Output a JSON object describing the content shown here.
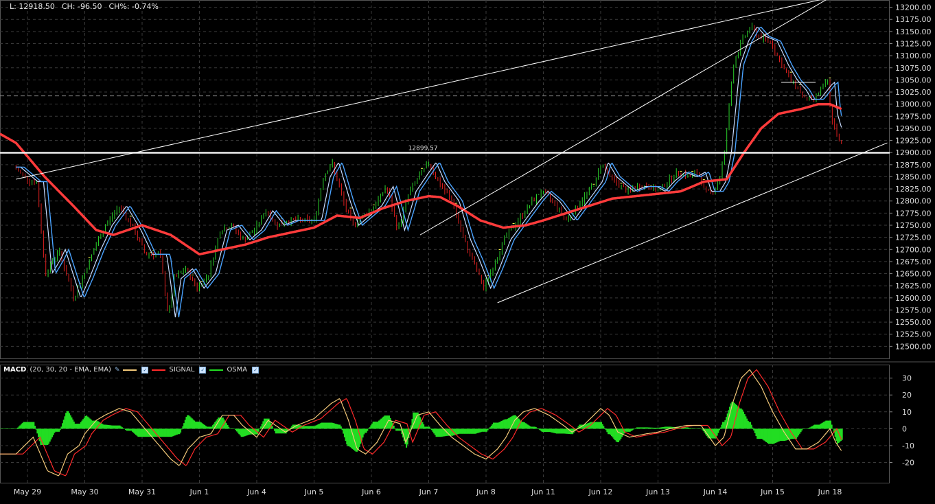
{
  "header": {
    "last": "L: 12918.50",
    "change": "CH: -96.50",
    "change_pct": "CH%: -0.74%"
  },
  "macd_legend": {
    "name": "MACD",
    "params": "(20, 30, 20 - EMA, EMA)",
    "signal_label": "SIGNAL",
    "osma_label": "OSMA",
    "macd_color": "#f2c879",
    "signal_color": "#ff2a2a",
    "osma_color": "#22dd22"
  },
  "colors": {
    "background": "#000000",
    "grid": "#3a3a3a",
    "up_candle": "#2bd42b",
    "down_candle": "#e02020",
    "fast_ma": "#4aa3ff",
    "slow_ma": "#ff3b3b",
    "trendline": "#ffffff",
    "marker": "#ffff55"
  },
  "chart_data": [
    {
      "type": "line",
      "title": "",
      "x_ticks": [
        "May 29",
        "May 30",
        "May 31",
        "Jun 1",
        "Jun 4",
        "Jun 5",
        "Jun 6",
        "Jun 7",
        "Jun 8",
        "Jun 11",
        "Jun 12",
        "Jun 13",
        "Jun 14",
        "Jun 15",
        "Jun 18"
      ],
      "ylim": [
        12475,
        13215
      ],
      "y_ticks": [
        12500,
        12525,
        12550,
        12575,
        12600,
        12625,
        12650,
        12675,
        12700,
        12725,
        12750,
        12775,
        12800,
        12825,
        12850,
        12875,
        12900,
        12925,
        12950,
        12975,
        13000,
        13025,
        13050,
        13075,
        13100,
        13125,
        13150,
        13175,
        13200
      ],
      "y_tick_labels": [
        "12500.00",
        "12525.00",
        "12550.00",
        "12575.00",
        "12600.00",
        "12625.00",
        "12650.00",
        "12675.00",
        "12700.00",
        "12725.00",
        "12750.00",
        "12775.00",
        "12800.00",
        "12825.00",
        "12850.00",
        "12875.00",
        "12900.00",
        "12925.00",
        "12950.00",
        "12975.00",
        "13000.00",
        "13025.00",
        "13050.00",
        "13075.00",
        "13100.00",
        "13125.00",
        "13150.00",
        "13175.00",
        "13200.00"
      ],
      "grid": true,
      "price_anchors": [
        [
          -0.2,
          12870
        ],
        [
          0.1,
          12840
        ],
        [
          0.2,
          12840
        ],
        [
          0.35,
          12650
        ],
        [
          0.5,
          12680
        ],
        [
          0.58,
          12700
        ],
        [
          0.85,
          12600
        ],
        [
          1.0,
          12640
        ],
        [
          1.2,
          12700
        ],
        [
          1.4,
          12750
        ],
        [
          1.65,
          12790
        ],
        [
          1.9,
          12740
        ],
        [
          2.1,
          12690
        ],
        [
          2.35,
          12690
        ],
        [
          2.5,
          12560
        ],
        [
          2.6,
          12640
        ],
        [
          2.8,
          12660
        ],
        [
          3.0,
          12620
        ],
        [
          3.2,
          12650
        ],
        [
          3.4,
          12740
        ],
        [
          3.6,
          12750
        ],
        [
          3.8,
          12720
        ],
        [
          4.0,
          12740
        ],
        [
          4.2,
          12780
        ],
        [
          4.4,
          12750
        ],
        [
          4.6,
          12760
        ],
        [
          4.8,
          12760
        ],
        [
          5.05,
          12760
        ],
        [
          5.2,
          12850
        ],
        [
          5.35,
          12880
        ],
        [
          5.55,
          12800
        ],
        [
          5.7,
          12750
        ],
        [
          5.9,
          12770
        ],
        [
          6.1,
          12790
        ],
        [
          6.3,
          12830
        ],
        [
          6.5,
          12740
        ],
        [
          6.7,
          12820
        ],
        [
          6.9,
          12855
        ],
        [
          7.05,
          12880
        ],
        [
          7.2,
          12840
        ],
        [
          7.45,
          12800
        ],
        [
          7.65,
          12720
        ],
        [
          7.8,
          12680
        ],
        [
          8.0,
          12620
        ],
        [
          8.15,
          12660
        ],
        [
          8.35,
          12720
        ],
        [
          8.6,
          12760
        ],
        [
          8.85,
          12800
        ],
        [
          9.0,
          12820
        ],
        [
          9.2,
          12800
        ],
        [
          9.45,
          12760
        ],
        [
          9.7,
          12800
        ],
        [
          9.95,
          12840
        ],
        [
          10.05,
          12880
        ],
        [
          10.2,
          12850
        ],
        [
          10.5,
          12820
        ],
        [
          10.7,
          12830
        ],
        [
          10.9,
          12830
        ],
        [
          11.05,
          12820
        ],
        [
          11.2,
          12840
        ],
        [
          11.4,
          12860
        ],
        [
          11.6,
          12850
        ],
        [
          11.75,
          12860
        ],
        [
          11.85,
          12820
        ],
        [
          12.0,
          12820
        ],
        [
          12.1,
          12840
        ],
        [
          12.2,
          12900
        ],
        [
          12.35,
          13080
        ],
        [
          12.5,
          13130
        ],
        [
          12.65,
          13160
        ],
        [
          12.8,
          13140
        ],
        [
          13.0,
          13130
        ],
        [
          13.2,
          13080
        ],
        [
          13.35,
          13050
        ],
        [
          13.5,
          13030
        ],
        [
          13.6,
          13010
        ],
        [
          13.75,
          13010
        ],
        [
          13.95,
          13040
        ],
        [
          14.0,
          13045
        ],
        [
          14.05,
          12980
        ],
        [
          14.15,
          12940
        ],
        [
          14.2,
          12920
        ]
      ],
      "series": [
        {
          "role": "fast_ma"
        },
        {
          "role": "slow_ma",
          "anchors": [
            [
              -0.5,
              12940
            ],
            [
              -0.2,
              12920
            ],
            [
              0.3,
              12850
            ],
            [
              0.8,
              12790
            ],
            [
              1.2,
              12740
            ],
            [
              1.5,
              12730
            ],
            [
              2.0,
              12750
            ],
            [
              2.5,
              12730
            ],
            [
              3.0,
              12690
            ],
            [
              3.4,
              12700
            ],
            [
              3.8,
              12710
            ],
            [
              4.2,
              12725
            ],
            [
              4.6,
              12735
            ],
            [
              5.0,
              12745
            ],
            [
              5.4,
              12770
            ],
            [
              5.8,
              12765
            ],
            [
              6.2,
              12785
            ],
            [
              6.6,
              12800
            ],
            [
              7.0,
              12810
            ],
            [
              7.2,
              12808
            ],
            [
              7.5,
              12790
            ],
            [
              7.9,
              12760
            ],
            [
              8.3,
              12745
            ],
            [
              8.7,
              12750
            ],
            [
              9.0,
              12760
            ],
            [
              9.4,
              12775
            ],
            [
              9.8,
              12790
            ],
            [
              10.2,
              12805
            ],
            [
              10.6,
              12810
            ],
            [
              11.0,
              12815
            ],
            [
              11.4,
              12820
            ],
            [
              11.8,
              12840
            ],
            [
              12.2,
              12845
            ],
            [
              12.5,
              12900
            ],
            [
              12.8,
              12950
            ],
            [
              13.1,
              12980
            ],
            [
              13.5,
              12990
            ],
            [
              13.8,
              13000
            ],
            [
              14.0,
              13000
            ],
            [
              14.2,
              12990
            ]
          ]
        }
      ],
      "horizontal_level": {
        "value": 12899.57,
        "label": "12899.57"
      },
      "trendlines": [
        {
          "from": [
            -0.2,
            12845
          ],
          "to": [
            14.0,
            13220
          ]
        },
        {
          "from": [
            6.85,
            12730
          ],
          "to": [
            14.0,
            13220
          ]
        },
        {
          "from": [
            8.2,
            12590
          ],
          "to": [
            15.0,
            12920
          ]
        },
        {
          "from": [
            13.15,
            13045
          ],
          "to": [
            13.75,
            13045
          ]
        }
      ],
      "current_price": 13017
    },
    {
      "type": "line",
      "title": "",
      "ylim": [
        -32,
        38
      ],
      "y_ticks": [
        30,
        20,
        10,
        0,
        -10,
        -20
      ],
      "y_tick_labels": [
        "30",
        "20",
        "10",
        "0",
        "-10",
        "-20"
      ],
      "grid": true,
      "series": [
        {
          "name": "SIGNAL",
          "role": "signal"
        },
        {
          "name": "OSMA",
          "role": "osma"
        }
      ],
      "macd_anchors": [
        [
          -0.2,
          -15
        ],
        [
          0.1,
          -5
        ],
        [
          0.35,
          -25
        ],
        [
          0.55,
          -28
        ],
        [
          0.7,
          -15
        ],
        [
          0.9,
          -10
        ],
        [
          1.0,
          -3
        ],
        [
          1.2,
          5
        ],
        [
          1.35,
          8
        ],
        [
          1.6,
          12
        ],
        [
          1.8,
          10
        ],
        [
          2.0,
          2
        ],
        [
          2.3,
          -10
        ],
        [
          2.5,
          -18
        ],
        [
          2.65,
          -22
        ],
        [
          2.8,
          -12
        ],
        [
          3.0,
          -5
        ],
        [
          3.2,
          -3
        ],
        [
          3.4,
          8
        ],
        [
          3.6,
          8
        ],
        [
          3.75,
          2
        ],
        [
          4.0,
          -5
        ],
        [
          4.2,
          5
        ],
        [
          4.5,
          -2
        ],
        [
          4.7,
          2
        ],
        [
          5.0,
          6
        ],
        [
          5.3,
          15
        ],
        [
          5.45,
          18
        ],
        [
          5.6,
          5
        ],
        [
          5.75,
          -12
        ],
        [
          5.9,
          -15
        ],
        [
          6.1,
          -8
        ],
        [
          6.3,
          5
        ],
        [
          6.5,
          3
        ],
        [
          6.6,
          -8
        ],
        [
          6.8,
          8
        ],
        [
          7.0,
          10
        ],
        [
          7.2,
          2
        ],
        [
          7.4,
          -5
        ],
        [
          7.6,
          -10
        ],
        [
          7.8,
          -15
        ],
        [
          8.0,
          -18
        ],
        [
          8.2,
          -12
        ],
        [
          8.35,
          -5
        ],
        [
          8.5,
          5
        ],
        [
          8.65,
          10
        ],
        [
          8.85,
          12
        ],
        [
          9.1,
          8
        ],
        [
          9.35,
          2
        ],
        [
          9.5,
          -2
        ],
        [
          9.7,
          2
        ],
        [
          10.0,
          12
        ],
        [
          10.15,
          8
        ],
        [
          10.3,
          -2
        ],
        [
          10.5,
          -5
        ],
        [
          10.8,
          -3
        ],
        [
          11.0,
          -2
        ],
        [
          11.2,
          0
        ],
        [
          11.5,
          2
        ],
        [
          11.75,
          2
        ],
        [
          12.0,
          -10
        ],
        [
          12.15,
          -5
        ],
        [
          12.3,
          15
        ],
        [
          12.45,
          30
        ],
        [
          12.6,
          35
        ],
        [
          12.8,
          25
        ],
        [
          13.0,
          10
        ],
        [
          13.2,
          -2
        ],
        [
          13.4,
          -12
        ],
        [
          13.6,
          -12
        ],
        [
          13.8,
          -8
        ],
        [
          13.95,
          -2
        ],
        [
          14.0,
          0
        ],
        [
          14.1,
          -8
        ],
        [
          14.2,
          -13
        ]
      ]
    }
  ]
}
